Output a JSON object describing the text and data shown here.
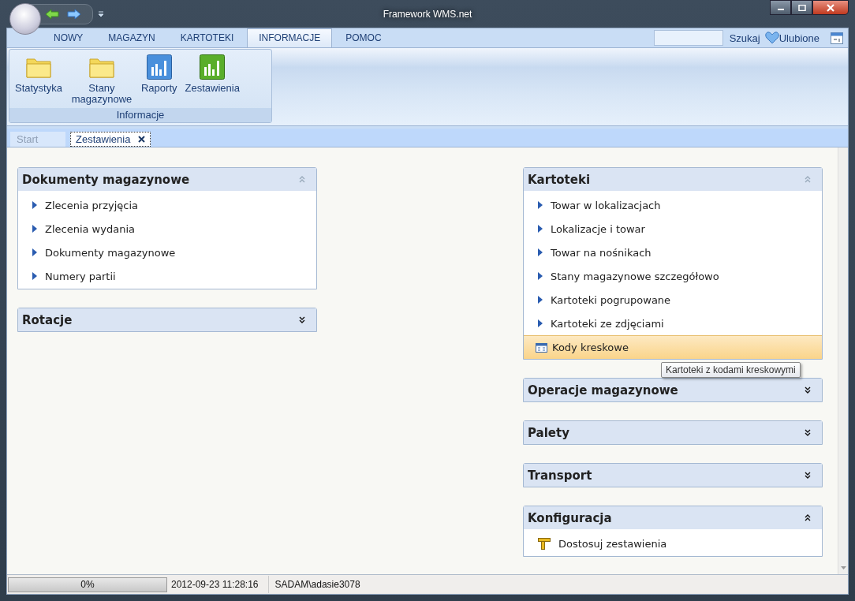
{
  "window": {
    "title": "Framework WMS.net"
  },
  "ribbon_tabs": [
    {
      "label": "NOWY",
      "selected": false
    },
    {
      "label": "MAGAZYN",
      "selected": false
    },
    {
      "label": "KARTOTEKI",
      "selected": false
    },
    {
      "label": "INFORMACJE",
      "selected": true
    },
    {
      "label": "POMOC",
      "selected": false
    }
  ],
  "search": {
    "button": "Szukaj"
  },
  "favorites": {
    "label": "Ulubione"
  },
  "ribbon_group": {
    "title": "Informacje",
    "buttons": [
      {
        "label": "Statystyka",
        "kind": "folder"
      },
      {
        "label": "Stany magazynowe",
        "kind": "folder"
      },
      {
        "label": "Raporty",
        "kind": "chart-blue"
      },
      {
        "label": "Zestawienia",
        "kind": "chart-green"
      }
    ]
  },
  "doc_tabs": [
    {
      "label": "Start",
      "selected": false,
      "closable": false
    },
    {
      "label": "Zestawienia",
      "selected": true,
      "closable": true
    }
  ],
  "columns": [
    {
      "panels": [
        {
          "title": "Dokumenty magazynowe",
          "expanded": true,
          "items": [
            {
              "label": "Zlecenia przyjęcia",
              "kind": "arrow",
              "highlighted": false
            },
            {
              "label": "Zlecenia wydania",
              "kind": "arrow",
              "highlighted": false
            },
            {
              "label": "Dokumenty magazynowe",
              "kind": "arrow",
              "highlighted": false
            },
            {
              "label": "Numery partii",
              "kind": "arrow",
              "highlighted": false
            }
          ]
        },
        {
          "title": "Rotacje",
          "expanded": false
        }
      ]
    },
    {
      "panels": [
        {
          "title": "Kartoteki",
          "expanded": true,
          "items": [
            {
              "label": "Towar w lokalizacjach",
              "kind": "arrow",
              "highlighted": false
            },
            {
              "label": "Lokalizacje i towar",
              "kind": "arrow",
              "highlighted": false
            },
            {
              "label": "Towar na nośnikach",
              "kind": "arrow",
              "highlighted": false
            },
            {
              "label": "Stany magazynowe szczegółowo",
              "kind": "arrow",
              "highlighted": false
            },
            {
              "label": "Kartoteki pogrupowane",
              "kind": "arrow",
              "highlighted": false
            },
            {
              "label": "Kartoteki ze zdjęciami",
              "kind": "arrow",
              "highlighted": false
            },
            {
              "label": "Kody kreskowe",
              "kind": "barcode",
              "highlighted": true
            }
          ]
        },
        {
          "title": "Operacje magazynowe",
          "expanded": false
        },
        {
          "title": "Palety",
          "expanded": false
        },
        {
          "title": "Transport",
          "expanded": false
        },
        {
          "title": "Konfiguracja",
          "expanded": true,
          "items": [
            {
              "label": "Dostosuj zestawienia",
              "kind": "ruler",
              "highlighted": false
            }
          ]
        }
      ]
    }
  ],
  "tooltip": {
    "text": "Kartoteki z kodami kreskowymi"
  },
  "status_bar": {
    "progress": {
      "reading": "0%",
      "level": 0
    },
    "datetime": "2012-09-23 11:28:16",
    "user": "SADAM\\adasie3078"
  }
}
